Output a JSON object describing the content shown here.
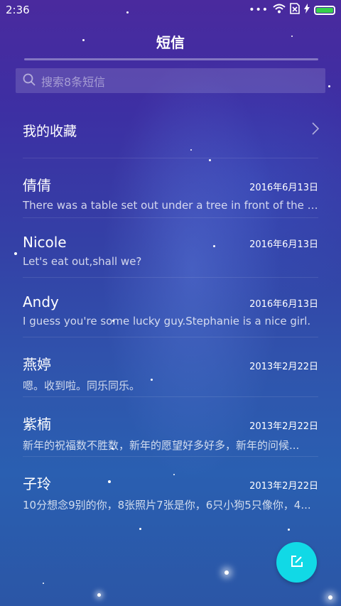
{
  "status_bar": {
    "time": "2:36",
    "icons": [
      "more-dots-icon",
      "wifi-icon",
      "sim-off-icon",
      "charging-bolt-icon",
      "battery-icon"
    ],
    "battery_color": "#36d04a"
  },
  "header": {
    "title": "短信"
  },
  "search": {
    "placeholder": "搜索8条短信",
    "icon": "search-icon"
  },
  "favorites": {
    "label": "我的收藏",
    "icon": "chevron-right-icon"
  },
  "messages": [
    {
      "name": "倩倩",
      "date": "2016年6月13日",
      "preview": "There was a table set out under a tree in front of the ho..."
    },
    {
      "name": "Nicole",
      "date": "2016年6月13日",
      "preview": "Let's eat out,shall we?"
    },
    {
      "name": "Andy",
      "date": "2016年6月13日",
      "preview": "I guess you're some lucky guy.Stephanie is a nice girl."
    },
    {
      "name": "燕婷",
      "date": "2013年2月22日",
      "preview": "嗯。收到啦。同乐同乐。"
    },
    {
      "name": "紫楠",
      "date": "2013年2月22日",
      "preview": "新年的祝福数不胜数，新年的愿望好多好多，新年的问候..."
    },
    {
      "name": "子玲",
      "date": "2013年2月22日",
      "preview": "10分想念9别的你，8张照片7张是你，6只小狗5只像你，4..."
    }
  ],
  "fab": {
    "icon": "compose-icon",
    "color": "#11d9e6"
  }
}
